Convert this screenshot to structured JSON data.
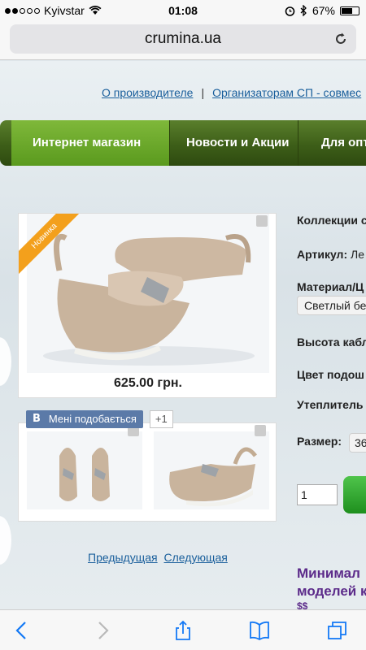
{
  "status_bar": {
    "carrier": "Kyivstar",
    "time": "01:08",
    "battery_text": "67%",
    "battery_level": 0.67
  },
  "browser": {
    "url": "crumina.ua"
  },
  "header": {
    "links": [
      "О производителе",
      "Организаторам СП - совмес"
    ],
    "separator": "|"
  },
  "nav": {
    "items": [
      "Интернет магазин",
      "Новости и Акции",
      "Для опто"
    ]
  },
  "product": {
    "badge": "Новинка",
    "price": "625.00 грн.",
    "like_label": "Мені подобається",
    "like_vk": "B",
    "like_count": "+1"
  },
  "specs": {
    "collection_label": "Коллекции с",
    "article_label": "Артикул:",
    "article_value": "Ле",
    "material_label": "Материал/Ц",
    "material_value": "Светлый бе",
    "heel_label": "Высота кабл",
    "sole_label": "Цвет подош",
    "lining_label": "Утеплитель",
    "size_label": "Размер:",
    "size_value": "36",
    "qty_value": "1"
  },
  "pager": {
    "prev": "Предыдущая",
    "next": "Следующая"
  },
  "promo": {
    "line1": "Минимал",
    "line2": "моделей к",
    "line3": "$$"
  }
}
